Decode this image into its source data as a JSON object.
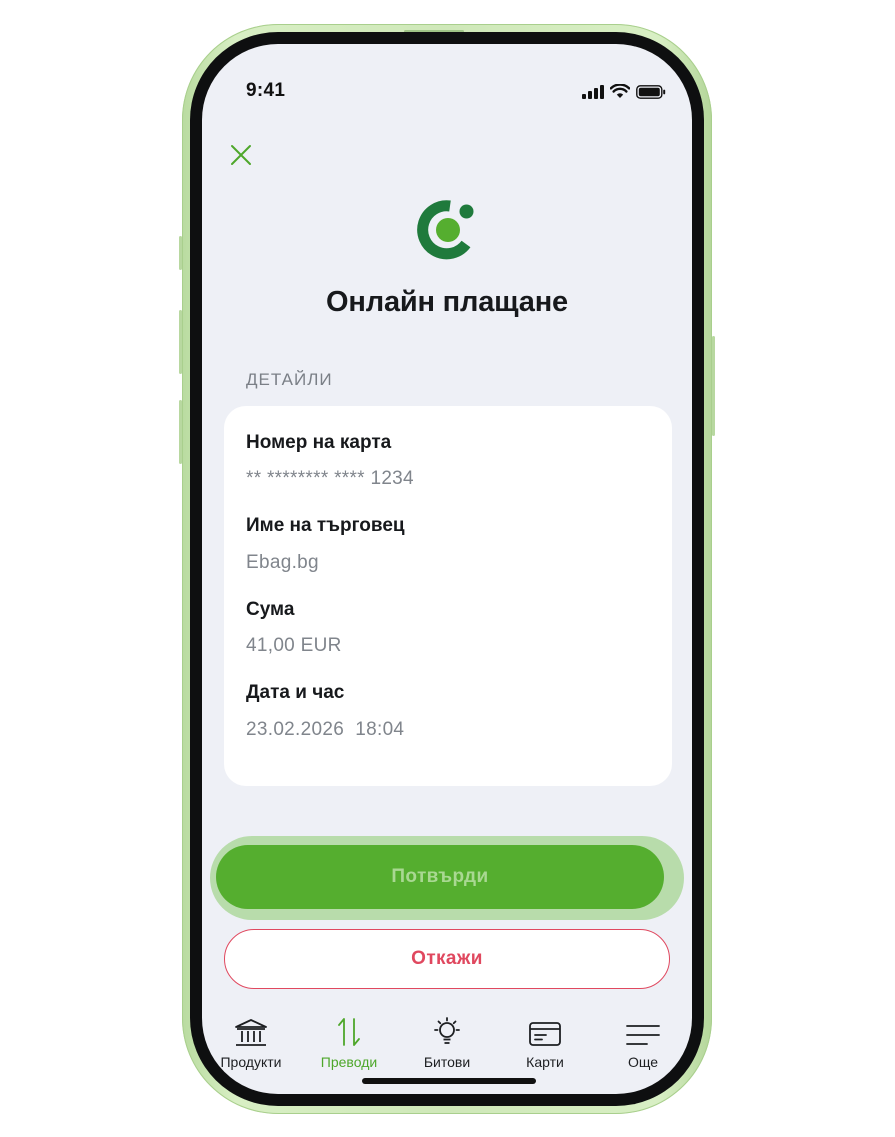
{
  "status_bar": {
    "time": "9:41"
  },
  "header": {
    "title": "Онлайн плащане"
  },
  "details": {
    "section_label": "ДЕТАЙЛИ",
    "items": [
      {
        "label": "Номер на карта",
        "value": "** ******** **** 1234"
      },
      {
        "label": "Име на търговец",
        "value": "Ebag.bg"
      },
      {
        "label": "Сума",
        "value": "41,00 EUR"
      },
      {
        "label": "Дата и час",
        "value": "23.02.2026  18:04"
      }
    ]
  },
  "actions": {
    "confirm_label": "Потвърди",
    "cancel_label": "Откажи"
  },
  "nav": {
    "items": [
      {
        "label": "Продукти",
        "icon": "bank-icon",
        "active": false
      },
      {
        "label": "Преводи",
        "icon": "transfer-arrows-icon",
        "active": true
      },
      {
        "label": "Битови",
        "icon": "bulb-icon",
        "active": false
      },
      {
        "label": "Карти",
        "icon": "card-icon",
        "active": false
      },
      {
        "label": "Още",
        "icon": "menu-icon",
        "active": false
      }
    ]
  },
  "colors": {
    "brand_green": "#55ae2f",
    "logo_dark_green": "#1f7a3c",
    "cancel_red": "#e0485f",
    "active_nav": "#4ea72b",
    "screen_bg": "#eef0f6"
  }
}
